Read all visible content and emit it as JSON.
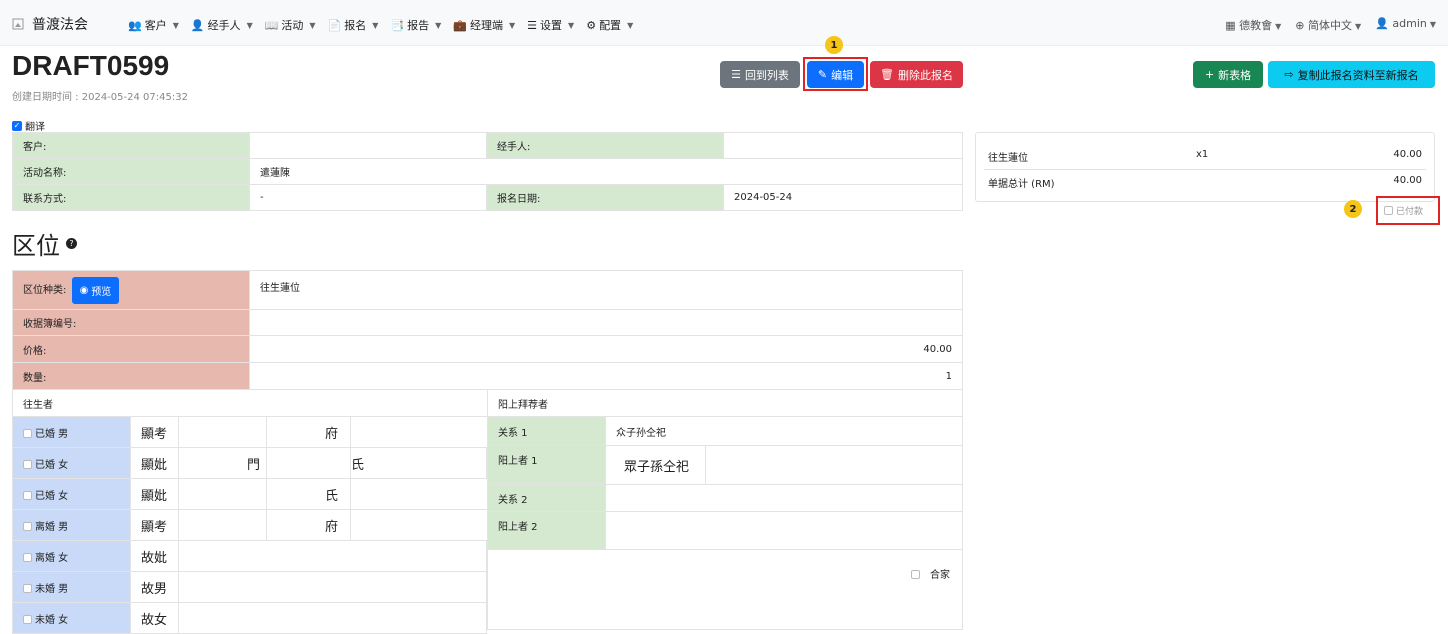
{
  "nav": {
    "brand": "普渡法会",
    "menu": [
      {
        "icon": "users-icon",
        "label": "客户"
      },
      {
        "icon": "user-icon",
        "label": "经手人"
      },
      {
        "icon": "book-icon",
        "label": "活动"
      },
      {
        "icon": "file-icon",
        "label": "报名"
      },
      {
        "icon": "report-icon",
        "label": "报告"
      },
      {
        "icon": "briefcase-icon",
        "label": "经理端"
      },
      {
        "icon": "settings-icon",
        "label": "设置"
      },
      {
        "icon": "gear-icon",
        "label": "配置"
      }
    ],
    "right": {
      "org": "德教會",
      "lang": "简体中文",
      "user": "admin"
    }
  },
  "page": {
    "title": "DRAFT0599",
    "created": "创建日期时间 : 2024-05-24 07:45:32",
    "translate_label": "翻译"
  },
  "buttons": {
    "back": "回到列表",
    "edit": "编辑",
    "delete": "删除此报名",
    "new_form": "新表格",
    "copy": "复制此报名资料至新报名"
  },
  "badges": {
    "one": "1",
    "two": "2"
  },
  "info": {
    "customer_label": "客户:",
    "customer_value": "",
    "handler_label": "经手人:",
    "handler_value": "",
    "event_label": "活动名称:",
    "event_value": "遣蓮陳",
    "contact_label": "联系方式:",
    "contact_value": "-",
    "date_label": "报名日期:",
    "date_value": "2024-05-24"
  },
  "summary": {
    "item": "往生蓮位",
    "qty": "x1",
    "amount": "40.00",
    "total_label": "单据总计 (RM)",
    "total": "40.00",
    "paid_label": "已付款"
  },
  "section": {
    "title": "区位"
  },
  "slot": {
    "type_label": "区位种类:",
    "preview": "预览",
    "type_value": "往生蓮位",
    "receipt_label": "收据簿编号:",
    "price_label": "价格:",
    "price_value": "40.00",
    "qty_label": "数量:",
    "qty_value": "1",
    "deceased_header": "往生者",
    "sponsor_header": "阳上拜荐者",
    "rows": [
      {
        "label": "已婚 男",
        "a": "顯考",
        "b": "",
        "c": "府"
      },
      {
        "label": "已婚 女",
        "a": "顯妣",
        "b": "門",
        "c": "氏"
      },
      {
        "label": "已婚 女",
        "a": "顯妣",
        "b": "",
        "c": "氏"
      },
      {
        "label": "离婚 男",
        "a": "顯考",
        "b": "",
        "c": "府"
      },
      {
        "label": "离婚 女",
        "a": "故妣",
        "b": "",
        "c": ""
      },
      {
        "label": "未婚 男",
        "a": "故男",
        "b": "",
        "c": ""
      },
      {
        "label": "未婚 女",
        "a": "故女",
        "b": "",
        "c": ""
      }
    ],
    "rel1_label": "关系 1",
    "rel1_value": "众子孙仝祀",
    "sp1_label": "阳上者 1",
    "sp1_value": "眾子孫仝祀",
    "rel2_label": "关系 2",
    "sp2_label": "阳上者 2",
    "family_label": "合家"
  },
  "colors": {
    "green": "#198754",
    "cyan": "#0dcaf0",
    "blue": "#0d6efd",
    "red": "#dc3545",
    "gray": "#6c757d",
    "badge": "#f5c518"
  }
}
